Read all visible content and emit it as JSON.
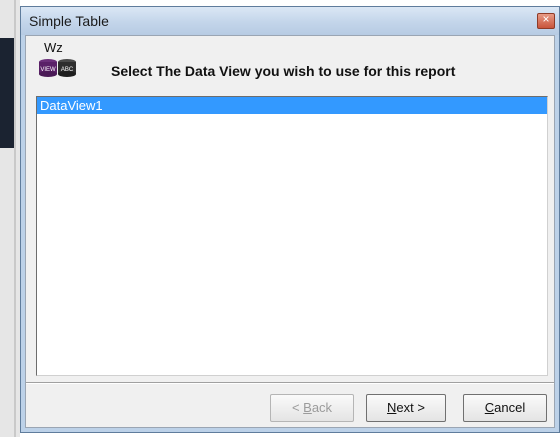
{
  "window": {
    "title": "Simple Table"
  },
  "header": {
    "logo_text": "Wz",
    "logo_label_left": "VIEW",
    "logo_label_right": "ABC",
    "instruction": "Select The Data View you wish to use for this report"
  },
  "dataviews": [
    {
      "label": "DataView1",
      "selected": true
    }
  ],
  "buttons": {
    "back": {
      "prefix": "< ",
      "accel": "B",
      "rest": "ack",
      "enabled": false
    },
    "next": {
      "prefix": "",
      "accel": "N",
      "rest": "ext >",
      "enabled": true
    },
    "cancel": {
      "prefix": "",
      "accel": "C",
      "rest": "ancel",
      "enabled": true
    }
  },
  "colors": {
    "selection": "#3399ff",
    "titlebar": "#c3d5ea"
  }
}
